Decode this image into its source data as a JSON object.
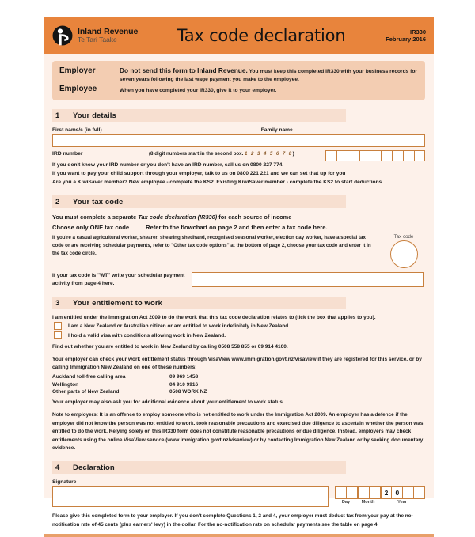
{
  "header": {
    "logo_icon": "inland-revenue-logo-icon",
    "org_name": "Inland Revenue",
    "org_name_maori": "Te Tari Taake",
    "title": "Tax code declaration",
    "form_code": "IR330",
    "form_date": "February 2016",
    "bg_color": "#e8843c"
  },
  "notice": {
    "employer_label": "Employer",
    "employee_label": "Employee",
    "employer_strong": "Do not send this form to Inland Revenue.",
    "employer_text": " You must keep this completed IR330 with your business records for seven years following the last wage payment you make to the employee.",
    "employee_text": "When you have completed your IR330, give it to your employer.",
    "bg_color": "#f3cdb2"
  },
  "section1": {
    "number": "1",
    "title": "Your details",
    "first_name_label": "First name/s (in full)",
    "family_name_label": "Family name",
    "first_name_value": "",
    "family_name_value": "",
    "ird_label": "IRD number",
    "ird_hint_pre": "(8 digit numbers start in the second box.",
    "ird_hint_digits": "1 2 3 4 5 6 7 8",
    "ird_hint_post": ")",
    "ird_cells": [
      "",
      "",
      "",
      "",
      "",
      "",
      "",
      "",
      ""
    ],
    "line_dont_know": "If you don't know your IRD number or you don't have an IRD number, call us on 0800 227 774.",
    "line_child_support": "If you want to pay your child support through your employer, talk to us on 0800 221 221 and we can set that up for you",
    "line_kiwisaver": "Are you a KiwiSaver member? New employee - complete the KS2. Existing KiwiSaver member - complete the KS2 to start deductions."
  },
  "section2": {
    "number": "2",
    "title": "Your tax code",
    "lead_pre": "You must complete a separate ",
    "lead_italic": "Tax code declaration (IR330)",
    "lead_post": " for each source of income",
    "choose_one": "Choose only ONE tax code",
    "refer_text": "Refer to the flowchart on page 2 and then enter a tax code here.",
    "para": "If you're a casual agricultural worker, shearer, shearing shedhand, recognised seasonal worker, election day worker, have a special tax code or are receiving schedular payments, refer to \"Other tax code options\" at the bottom of page 2, choose your tax code and enter it in the tax code circle.",
    "tax_code_circle_label": "Tax code",
    "tax_code_value": "",
    "wt_label": "If your tax code is \"WT\" write your schedular payment activity from page 4 here.",
    "wt_value": ""
  },
  "section3": {
    "number": "3",
    "title": "Your entitlement to work",
    "lead": "I am entitled under the Immigration Act 2009 to do the work that this tax code declaration relates to (tick the box that applies to you).",
    "checkboxes": [
      {
        "checked": false,
        "label": "I am a New Zealand or Australian citizen or am entitled to work indefinitely in New Zealand."
      },
      {
        "checked": false,
        "label": "I hold a valid visa with conditions allowing work in New Zealand."
      }
    ],
    "find_out": "Find out whether you are entitled to work in New Zealand by calling 0508 558 855 or 09 914 4100.",
    "visaview_para": "Your employer can check your work entitlement status through VisaView www.immigration.govt.nz/visaview if they are registered for this service, or by calling Immigration New Zealand on one of these numbers:",
    "phones": [
      {
        "region": "Auckland toll-free calling area",
        "number": "09 969 1458"
      },
      {
        "region": "Wellington",
        "number": "04 910 9916"
      },
      {
        "region": "Other parts of New Zealand",
        "number": "0508 WORK NZ"
      }
    ],
    "additional_evidence": "Your employer may also ask you for additional evidence about your entitlement to work status.",
    "note_label": "Note to employers:",
    "note_text": " It is an offence to employ someone who is not entitled to work under the Immigration Act 2009. An employer has a defence if the employer did not know the person was not entitled to work, took reasonable precautions and exercised due diligence to ascertain whether the person was entitled to do the work. Relying solely on this IR330 form does not constitute reasonable precautions or due diligence. Instead, employers may check entitlements using the online VisaView service (www.immigration.govt.nz/visaview) or by contacting Immigration New Zealand or by seeking documentary evidence."
  },
  "section4": {
    "number": "4",
    "title": "Declaration",
    "signature_label": "Signature",
    "signature_value": "",
    "date_cells": [
      "",
      "",
      "",
      "",
      "2",
      "0",
      "",
      ""
    ],
    "day_label": "Day",
    "month_label": "Month",
    "year_label": "Year"
  },
  "footer": {
    "text": "Please give this completed form to your employer. If you don't complete Questions 1, 2 and 4, your employer must deduct tax from your pay at the no-notification rate of 45 cents (plus earners' levy) in the dollar. For the no-notification rate on schedular payments see the table on page 4."
  },
  "colors": {
    "page_bg": "#fdf1ea",
    "header_orange": "#e8843c",
    "section_bar": "#f7dfd0",
    "field_border": "#c8803e"
  }
}
